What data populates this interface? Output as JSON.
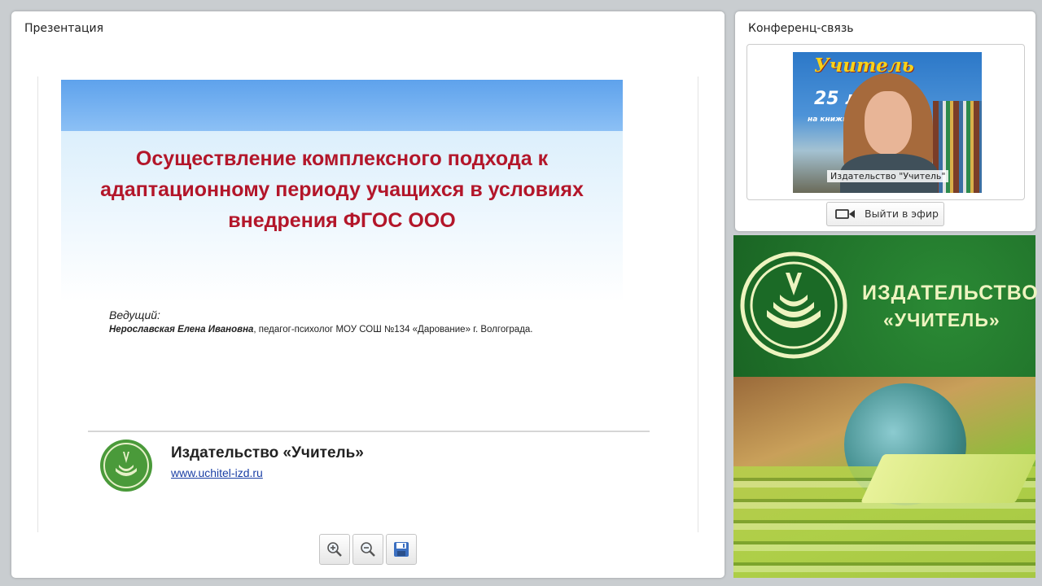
{
  "presentation": {
    "title": "Презентация",
    "slide": {
      "title": "Осуществление комплексного подхода к адаптационному периоду учащихся в условиях внедрения ФГОС ООО",
      "presenter_label": "Ведущий:",
      "presenter_name": "Нерославская Елена Ивановна",
      "presenter_details": ", педагог-психолог  МОУ СОШ №134 «Дарование»  г. Волгограда.",
      "publisher_name": "Издательство «Учитель»",
      "publisher_url": "www.uchitel-izd.ru"
    },
    "toolbar": {
      "zoom_in": "zoom-in-icon",
      "zoom_out": "zoom-out-icon",
      "save": "save-icon"
    }
  },
  "conference": {
    "title": "Конференц-связь",
    "video": {
      "backdrop_line1": "Учитель",
      "backdrop_line2": "25 л",
      "backdrop_line3": "на книжн",
      "caption": "Издательство \"Учитель\""
    },
    "go_live_label": "Выйти в эфир"
  },
  "banner": {
    "line1": "ИЗДАТЕЛЬСТВО",
    "line2": "«УЧИТЕЛЬ»"
  },
  "colors": {
    "slide_title": "#b3162a",
    "banner_green": "#1f7a2c",
    "link": "#1a3fa5"
  }
}
